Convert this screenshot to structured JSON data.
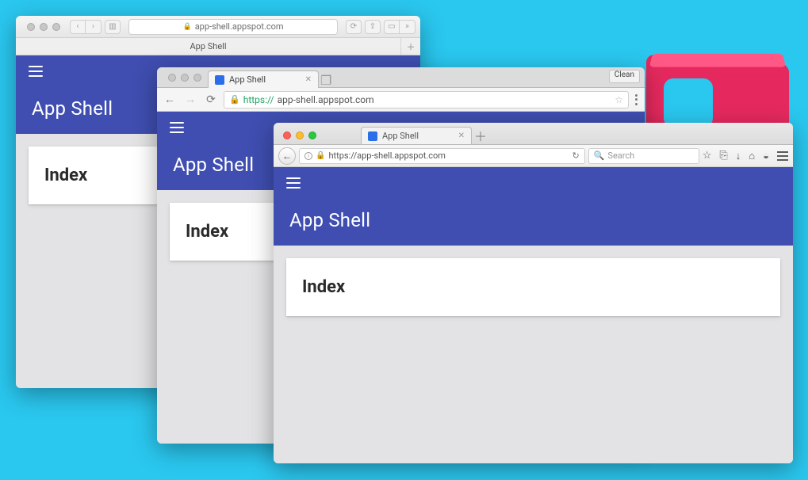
{
  "safari": {
    "url_display": "app-shell.appspot.com",
    "tab_title": "App Shell",
    "app_title": "App Shell",
    "card_title": "Index"
  },
  "chrome": {
    "tab_title": "App Shell",
    "clean_button": "Clean",
    "url_proto": "https://",
    "url_rest": "app-shell.appspot.com",
    "app_title": "App Shell",
    "card_title": "Index"
  },
  "firefox": {
    "tab_title": "App Shell",
    "url": "https://app-shell.appspot.com",
    "search_placeholder": "Search",
    "app_title": "App Shell",
    "card_title": "Index"
  }
}
